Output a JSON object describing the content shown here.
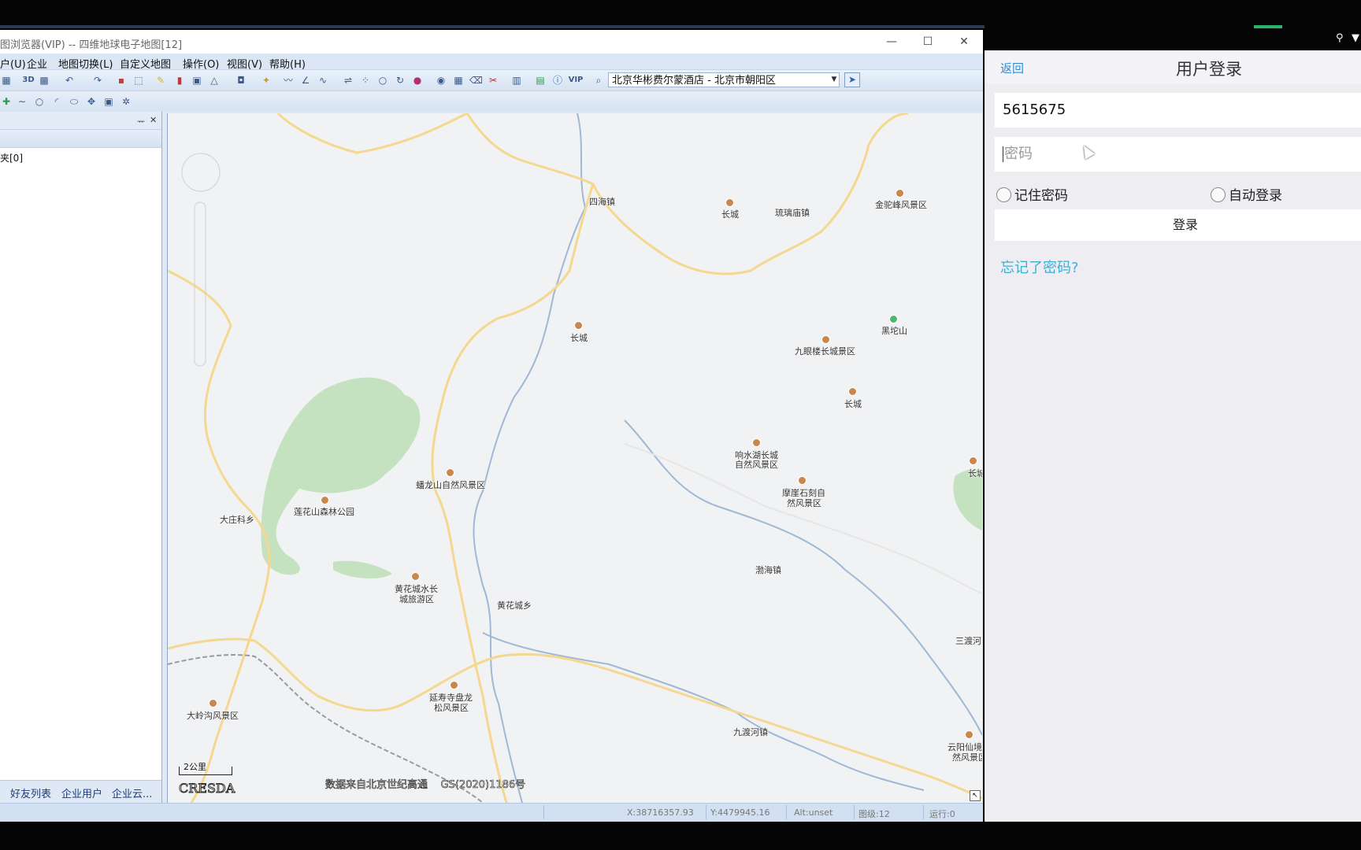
{
  "window": {
    "title": "图浏览器(VIP) -- 四维地球电子地图[12]",
    "controls": {
      "minimize": "—",
      "maximize": "☐",
      "close": "✕"
    }
  },
  "menu": {
    "items": [
      "户(U)",
      "企业",
      "地图切换(L)",
      "自定义地图",
      "操作(O)",
      "视图(V)",
      "帮助(H)"
    ]
  },
  "toolbar": {
    "search_value": "北京华彬费尔蒙酒店 - 北京市朝阳区",
    "btn_3d": "3D",
    "btn_vip": "VIP"
  },
  "left_panel": {
    "pin": "ᅲ",
    "close": "✕",
    "item": "夹[0]",
    "tabs": [
      "好友列表",
      "企业用户",
      "企业云..."
    ]
  },
  "map": {
    "labels": [
      {
        "id": "sihaizhen",
        "text": "四海镇"
      },
      {
        "id": "changcheng1",
        "text": "长城"
      },
      {
        "id": "liulimiao",
        "text": "琉璃庙镇"
      },
      {
        "id": "jintuofeng",
        "text": "金驼峰风景区"
      },
      {
        "id": "changcheng2",
        "text": "长城"
      },
      {
        "id": "heituoshan",
        "text": "黑坨山"
      },
      {
        "id": "jiuyanlou",
        "text": "九眼楼长城景区"
      },
      {
        "id": "changcheng3",
        "text": "长城"
      },
      {
        "id": "xiangshuihu",
        "text": "响水湖长城"
      },
      {
        "id": "xiangshuihu2",
        "text": "自然风景区"
      },
      {
        "id": "moya",
        "text": "摩崖石刻自"
      },
      {
        "id": "moya2",
        "text": "然风景区"
      },
      {
        "id": "changcheng4",
        "text": "长城"
      },
      {
        "id": "panlongshan",
        "text": "蟠龙山自然风景区"
      },
      {
        "id": "lianhuashan",
        "text": "莲花山森林公园"
      },
      {
        "id": "dazhuangke",
        "text": "大庄科乡"
      },
      {
        "id": "bohaizhen",
        "text": "渤海镇"
      },
      {
        "id": "huanghuacheng",
        "text": "黄花城水长"
      },
      {
        "id": "huanghuacheng2",
        "text": "城旅游区"
      },
      {
        "id": "huanghuachengxiang",
        "text": "黄花城乡"
      },
      {
        "id": "sanduhe",
        "text": "三渡河"
      },
      {
        "id": "yanshousi",
        "text": "延寿寺盘龙"
      },
      {
        "id": "yanshousi2",
        "text": "松风景区"
      },
      {
        "id": "dalinggou",
        "text": "大岭沟风景区"
      },
      {
        "id": "jiuduhe",
        "text": "九渡河镇"
      },
      {
        "id": "yunyang",
        "text": "云阳仙境"
      },
      {
        "id": "yunyang2",
        "text": "然风景区"
      }
    ],
    "scale": "2公里",
    "logo": "CRESDA",
    "attribution": "数据来自北京世纪高通    GS(2020)1186号"
  },
  "status": {
    "x": "X:38716357.93",
    "y": "Y:4479945.16",
    "alt": "Alt:unset",
    "level": "图级:12",
    "run": "运行:0"
  },
  "phone": {
    "back": "返回",
    "title": "用户登录",
    "username_value": "5615675",
    "password_placeholder": "密码",
    "remember": "记住密码",
    "autologin": "自动登录",
    "login_button": "登录",
    "forgot": "忘记了密码?"
  },
  "colors": {
    "map_bg": "#f1f2f4",
    "forest": "#c4e2c0",
    "road": "#f5d88f",
    "river": "#9fb8d3",
    "accent_link": "#3cb0d4"
  }
}
